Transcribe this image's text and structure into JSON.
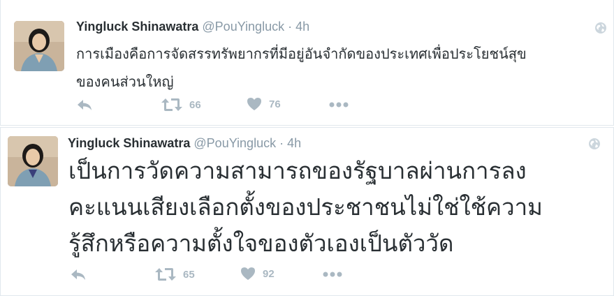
{
  "tweets": [
    {
      "name": "Yingluck Shinawatra",
      "handle": "@PouYingluck",
      "separator": "·",
      "time": "4h",
      "text_lines": [
        "การเมืองคือการจัดสรรทรัพยากรที่มีอยู่อันจำกัดของประเทศเพื่อประโยชน์สุข",
        "ของคนส่วนใหญ่"
      ],
      "retweets": "66",
      "likes": "76"
    },
    {
      "name": "Yingluck Shinawatra",
      "handle": "@PouYingluck",
      "separator": "·",
      "time": "4h",
      "text_lines": [
        "เป็นการวัดความสามารถของรัฐบาลผ่านการลง",
        "คะแนนเสียงเลือกตั้งของประชาชนไม่ใช่ใช้ความ",
        "รู้สึกหรือความตั้งใจของตัวเองเป็นตัววัด"
      ],
      "retweets": "65",
      "likes": "92"
    }
  ],
  "icons": {
    "avatar": "profile-photo",
    "globe": "globe-icon",
    "reply": "reply-icon",
    "retweet": "retweet-icon",
    "like": "heart-icon",
    "more": "more-dots-icon"
  },
  "colors": {
    "text": "#292f33",
    "muted": "#8899a6",
    "action": "#aab8c2",
    "border": "#e1e8ed"
  }
}
